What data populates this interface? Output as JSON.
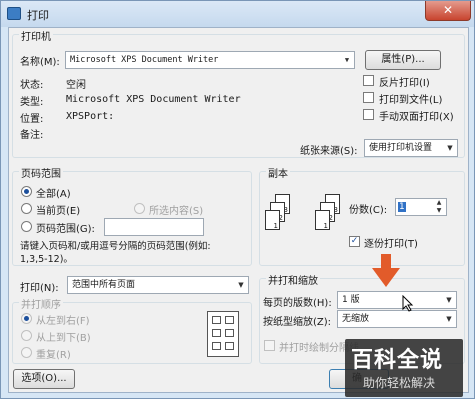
{
  "window": {
    "title": "打印",
    "close_glyph": "✕"
  },
  "printer": {
    "group_label": "打印机",
    "name_label": "名称(M):",
    "name_value": "Microsoft XPS Document Writer",
    "properties_button": "属性(P)...",
    "status_label": "状态:",
    "status_value": "空闲",
    "type_label": "类型:",
    "type_value": "Microsoft XPS Document Writer",
    "where_label": "位置:",
    "where_value": "XPSPort:",
    "comment_label": "备注:",
    "reverse_print": "反片打印(I)",
    "print_to_file": "打印到文件(L)",
    "manual_duplex": "手动双面打印(X)",
    "paper_source_label": "纸张来源(S):",
    "paper_source_value": "使用打印机设置"
  },
  "page_range": {
    "group_label": "页码范围",
    "all": "全部(A)",
    "current": "当前页(E)",
    "selection": "所选内容(S)",
    "pages": "页码范围(G):",
    "pages_value": "",
    "hint_line1": "请键入页码和/或用逗号分隔的页码范围(例如:",
    "hint_line2": "1,3,5-12)。"
  },
  "print_what": {
    "label": "打印(N):",
    "value": "范围中所有页面"
  },
  "print_order": {
    "group_label": "并打顺序",
    "left_to_right": "从左到右(F)",
    "top_to_bottom": "从上到下(B)",
    "repeat": "重复(R)"
  },
  "copies": {
    "group_label": "副本",
    "count_label": "份数(C):",
    "count_value": "1",
    "collate": "逐份打印(T)"
  },
  "zoom": {
    "group_label": "并打和缩放",
    "pages_per_sheet_label": "每页的版数(H):",
    "pages_per_sheet_value": "1 版",
    "scale_label": "按纸型缩放(Z):",
    "scale_value": "无缩放",
    "draw_borders": "并打时绘制分隔线"
  },
  "footer": {
    "options_button": "选项(O)...",
    "ok_button": "确"
  },
  "watermark": {
    "line1": "百科全说",
    "line2": "助你轻松解决"
  },
  "colors": {
    "accent": "#e25b2a",
    "watermark_bg": "#2b2b2b"
  }
}
